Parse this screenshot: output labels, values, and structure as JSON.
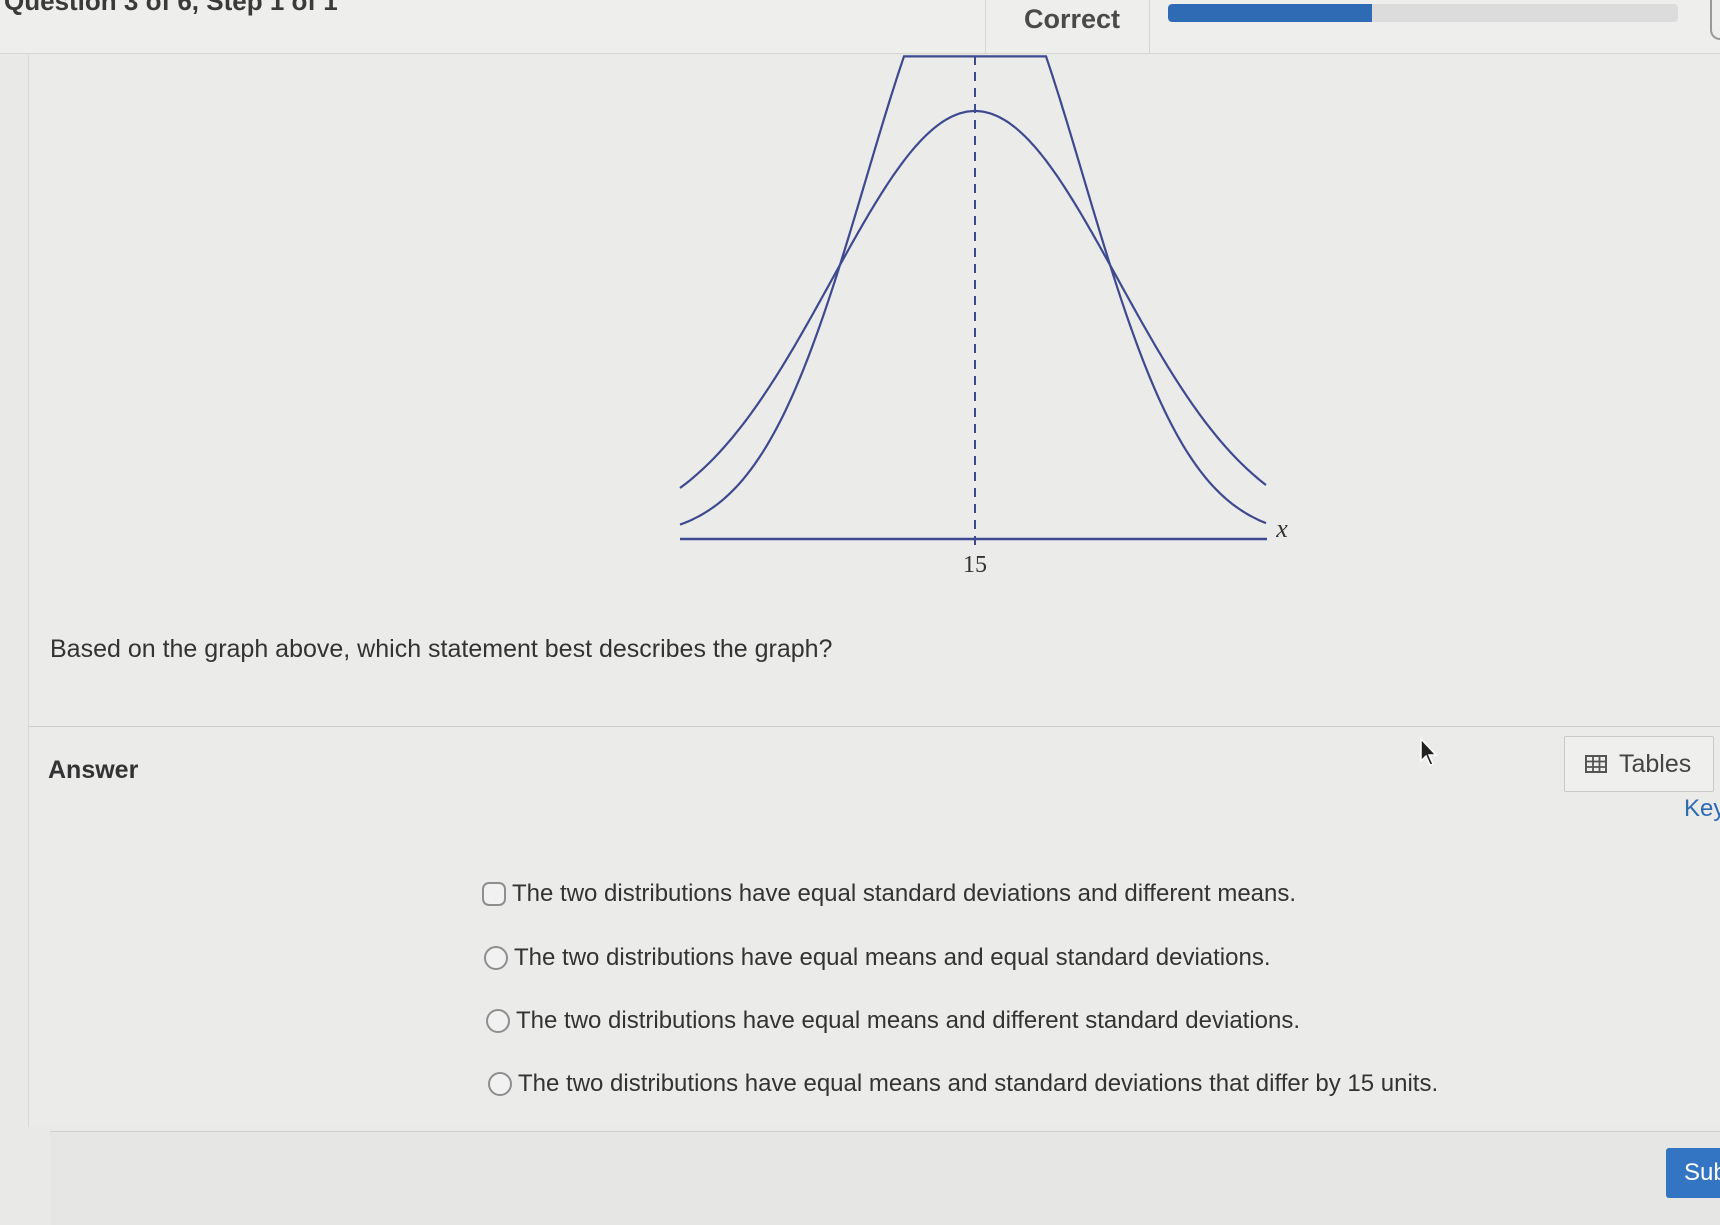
{
  "header": {
    "question_progress": "Question 3 of 6, Step 1 of 1",
    "status": "Correct",
    "progress_fraction": 0.4
  },
  "graph": {
    "center_tick_label": "15",
    "x_axis_label": "x"
  },
  "question": {
    "text": "Based on the graph above, which statement best describes the graph?"
  },
  "answer": {
    "label": "Answer",
    "options": [
      "The two distributions have equal standard deviations and different means.",
      "The two distributions have equal means and equal standard deviations.",
      "The two distributions have equal means and different standard deviations.",
      "The two distributions have equal means and standard deviations that differ by 15 units."
    ]
  },
  "toolbar": {
    "tables_label": "Tables",
    "keypad_label": "Key"
  },
  "footer": {
    "submit_label": "Sub"
  },
  "colors": {
    "accent": "#2f6bb5",
    "curve": "#3d4a8f",
    "submit": "#3375c2"
  },
  "icons": {
    "tables": "table-grid-icon",
    "cursor": "mouse-pointer-icon"
  }
}
